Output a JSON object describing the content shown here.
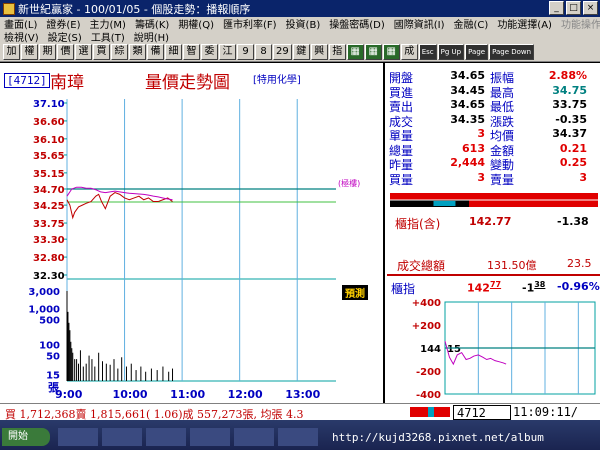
{
  "window": {
    "title": "新世紀贏家 - 100/01/05 - 個股走勢：播報順序",
    "buttons": [
      "_",
      "□",
      "×"
    ]
  },
  "menu": {
    "row1": [
      "畫面(L)",
      "證券(E)",
      "主力(M)",
      "籌碼(K)",
      "期權(Q)",
      "匯市利率(F)",
      "投資(B)",
      "操盤密碼(D)",
      "國際資訊(I)",
      "金融(C)",
      "功能選擇(A)",
      "功能操作(D)"
    ],
    "row2": [
      "檢視(V)",
      "設定(S)",
      "工具(T)",
      "說明(H)"
    ]
  },
  "toolbar": {
    "items": [
      "加",
      "權",
      "期",
      "價",
      "選",
      "買",
      "綜",
      "類",
      "備",
      "細",
      "智",
      "委",
      "江",
      "9",
      "8",
      "29",
      "鍵",
      "興",
      "指",
      "▦",
      "▦",
      "▦",
      "成",
      "Esc",
      "Pg Up",
      "Page",
      "Page Down"
    ]
  },
  "chart_header": {
    "code": "4712",
    "name": "南璋",
    "title": "量價走勢圖",
    "sector": "[特用化學]"
  },
  "chart_data": {
    "type": "line",
    "title": "量價走勢圖",
    "price_axis": {
      "ticks": [
        "37.10",
        "36.60",
        "36.10",
        "35.65",
        "35.15",
        "34.70",
        "34.25",
        "33.75",
        "33.30",
        "32.80",
        "32.30"
      ],
      "ylim": [
        32.3,
        37.1
      ],
      "reference": 34.7
    },
    "volume_axis": {
      "ticks": [
        "3,000",
        "1,000",
        "500",
        "100",
        "50",
        "15"
      ],
      "unit": "張"
    },
    "x_ticks": [
      "9:00",
      "10:00",
      "11:00",
      "12:00",
      "13:00"
    ],
    "session_minutes": [
      0,
      270
    ],
    "series": [
      {
        "color": "#c00000",
        "x": [
          0,
          3,
          6,
          8,
          12,
          16,
          20,
          25,
          30,
          33,
          36,
          40,
          45,
          50,
          55,
          60,
          65,
          70,
          75,
          80,
          85,
          90,
          95,
          100,
          105,
          110
        ],
        "y": [
          34.4,
          34.25,
          33.9,
          34.05,
          34.2,
          34.25,
          34.3,
          34.35,
          34.5,
          34.55,
          34.35,
          34.15,
          34.5,
          34.6,
          34.55,
          34.45,
          34.4,
          34.45,
          34.5,
          34.4,
          34.45,
          34.35,
          34.35,
          34.4,
          34.45,
          34.35
        ]
      },
      {
        "color": "#c000c0",
        "x": [
          0,
          5,
          10,
          15,
          20,
          25,
          30,
          35,
          40,
          45,
          50,
          55,
          60,
          65,
          70,
          75,
          80,
          85,
          90,
          95,
          100,
          105,
          110
        ],
        "y": [
          34.5,
          34.7,
          34.75,
          34.75,
          34.72,
          34.72,
          34.68,
          34.62,
          34.6,
          34.62,
          34.64,
          34.62,
          34.6,
          34.58,
          34.57,
          34.56,
          34.55,
          34.53,
          34.5,
          34.48,
          34.45,
          34.42,
          34.4
        ]
      }
    ],
    "volume_bars": {
      "x": [
        0,
        1,
        2,
        3,
        4,
        5,
        6,
        8,
        10,
        12,
        14,
        17,
        20,
        23,
        26,
        29,
        33,
        37,
        41,
        45,
        49,
        53,
        57,
        62,
        67,
        72,
        77,
        82,
        88,
        94,
        100,
        106,
        110
      ],
      "v": [
        3000,
        800,
        400,
        250,
        120,
        80,
        60,
        40,
        40,
        30,
        70,
        25,
        30,
        50,
        40,
        25,
        60,
        35,
        30,
        28,
        40,
        22,
        45,
        25,
        30,
        20,
        25,
        18,
        22,
        20,
        25,
        18,
        22
      ]
    }
  },
  "chart_labels": {
    "reference_tag": "(極樓)",
    "prepost_tag": "預測"
  },
  "quote": {
    "rows": [
      {
        "l1": "開盤",
        "v1": "34.65",
        "l2": "振幅",
        "v2": "2.88%",
        "c2": "red"
      },
      {
        "l1": "買進",
        "v1": "34.45",
        "l2": "最高",
        "v2": "34.75",
        "c2": "teal"
      },
      {
        "l1": "賣出",
        "v1": "34.65",
        "l2": "最低",
        "v2": "33.75",
        "c2": "black"
      },
      {
        "l1": "成交",
        "v1": "34.35",
        "l2": "漲跌",
        "v2": "-0.35",
        "c2": "black"
      },
      {
        "l1": "單量",
        "v1": "3",
        "l2": "均價",
        "v2": "34.37",
        "c2": "black",
        "c1": "red"
      },
      {
        "l1": "總量",
        "v1": "613",
        "l2": "金額",
        "v2": "0.21",
        "c2": "red",
        "c1": "red"
      },
      {
        "l1": "昨量",
        "v1": "2,444",
        "l2": "變動",
        "v2": "0.25",
        "c2": "red",
        "c1": "red"
      },
      {
        "l1": "買量",
        "v1": "3",
        "l2": "賣量",
        "v2": "3",
        "c2": "red",
        "c1": "red"
      }
    ],
    "bid_ratio": 0.38
  },
  "index_summary": {
    "label": "櫃指(含)",
    "value": "142.77",
    "change": "-1.38"
  },
  "turnover": {
    "label": "成交總額",
    "value": "131.50億",
    "change": "23.5"
  },
  "index_mini": {
    "label": "櫃指",
    "value_int": "142",
    "value_dec": "77",
    "change_int": "-1",
    "change_dec": "38",
    "pct": "-0.96%",
    "y_ticks": [
      "+400",
      "+200",
      "144",
      "-200",
      "-400"
    ],
    "ref_label": "15",
    "series": {
      "x": [
        0,
        8,
        15,
        22,
        30,
        38,
        45,
        52,
        60,
        68,
        75,
        82,
        90,
        98,
        105,
        110
      ],
      "y": [
        60,
        -80,
        -140,
        -60,
        -40,
        -100,
        -90,
        -70,
        -60,
        -80,
        -100,
        -90,
        -110,
        -120,
        -130,
        -140
      ]
    }
  },
  "status": {
    "text": "買 1,712,368賣 1,815,661( 1.06)成 557,273張, 均張 4.3",
    "code": "4712",
    "time": "11:09:11/"
  },
  "taskbar": {
    "start": "開始",
    "watermark": "http://kujd3268.pixnet.net/album"
  }
}
